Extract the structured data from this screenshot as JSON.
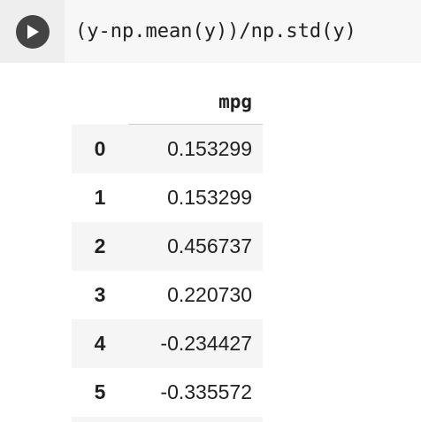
{
  "code_cell": {
    "source": "(y-np.mean(y))/np.std(y)",
    "run_icon": "play-icon"
  },
  "output_table": {
    "column_header": "mpg",
    "rows": [
      {
        "index": "0",
        "value": "0.153299"
      },
      {
        "index": "1",
        "value": "0.153299"
      },
      {
        "index": "2",
        "value": "0.456737"
      },
      {
        "index": "3",
        "value": "0.220730"
      },
      {
        "index": "4",
        "value": "-0.234427"
      },
      {
        "index": "5",
        "value": "-0.335572"
      }
    ]
  },
  "colors": {
    "gutter": "#eeeeee",
    "code_background": "#f7f7f7",
    "run_button": "#444444",
    "striped_row": "#f5f5f5"
  }
}
